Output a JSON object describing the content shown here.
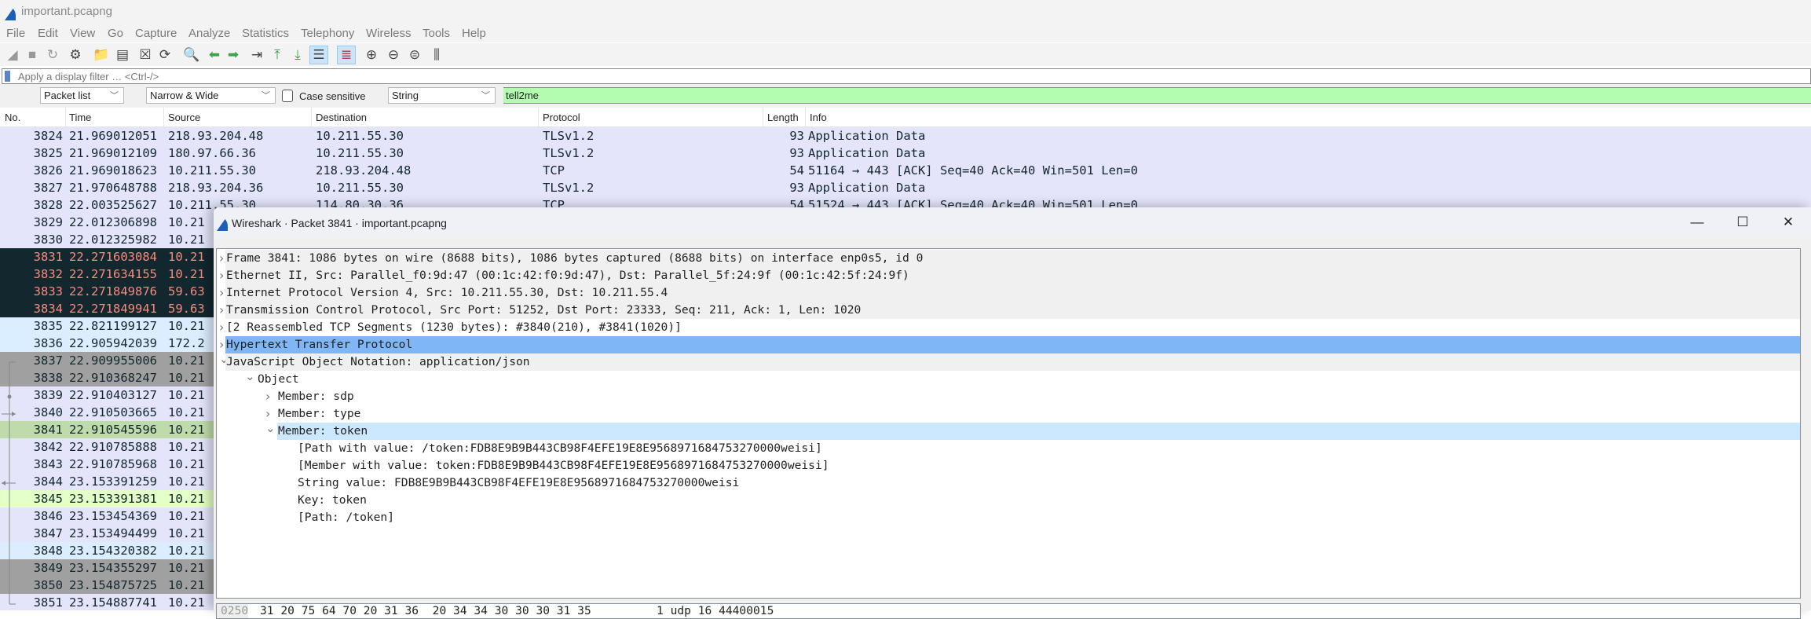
{
  "window": {
    "title": "important.pcapng",
    "icon": "wireshark-fin-icon"
  },
  "menu": [
    "File",
    "Edit",
    "View",
    "Go",
    "Capture",
    "Analyze",
    "Statistics",
    "Telephony",
    "Wireless",
    "Tools",
    "Help"
  ],
  "toolbar": {
    "icons": [
      "start-capture-icon",
      "stop-capture-icon",
      "restart-capture-icon",
      "capture-options-icon",
      "open-file-icon",
      "save-file-icon",
      "close-file-icon",
      "reload-file-icon",
      "find-packet-icon",
      "go-back-icon",
      "go-forward-icon",
      "go-to-packet-icon",
      "go-first-icon",
      "go-last-icon",
      "autoscroll-icon",
      "colorize-icon",
      "zoom-in-icon",
      "zoom-out-icon",
      "normal-size-icon",
      "resize-columns-icon"
    ]
  },
  "display_filter": {
    "placeholder": "Apply a display filter … <Ctrl-/>"
  },
  "find_bar": {
    "search_in": "Packet list",
    "char_width": "Narrow & Wide",
    "case_sensitive_label": "Case sensitive",
    "case_sensitive": false,
    "search_type": "String",
    "search_value": "tell2me"
  },
  "packet_list": {
    "columns": [
      "No.",
      "Time",
      "Source",
      "Destination",
      "Protocol",
      "Length",
      "Info"
    ],
    "rows": [
      {
        "no": "3824",
        "time": "21.969012051",
        "source": "218.93.204.48",
        "destination": "10.211.55.30",
        "protocol": "TLSv1.2",
        "length": "93",
        "info": "Application Data",
        "style": "tcp"
      },
      {
        "no": "3825",
        "time": "21.969012109",
        "source": "180.97.66.36",
        "destination": "10.211.55.30",
        "protocol": "TLSv1.2",
        "length": "93",
        "info": "Application Data",
        "style": "tcp"
      },
      {
        "no": "3826",
        "time": "21.969018623",
        "source": "10.211.55.30",
        "destination": "218.93.204.48",
        "protocol": "TCP",
        "length": "54",
        "info": "51164 → 443 [ACK] Seq=40 Ack=40 Win=501 Len=0",
        "style": "tcp"
      },
      {
        "no": "3827",
        "time": "21.970648788",
        "source": "218.93.204.36",
        "destination": "10.211.55.30",
        "protocol": "TLSv1.2",
        "length": "93",
        "info": "Application Data",
        "style": "tcp"
      },
      {
        "no": "3828",
        "time": "22.003525627",
        "source": "10.211.55.30",
        "destination": "114.80.30.36",
        "protocol": "TCP",
        "length": "54",
        "info": "51524 → 443 [ACK] Seq=40 Ack=40 Win=501 Len=0",
        "style": "tcp"
      },
      {
        "no": "3829",
        "time": "22.012306898",
        "source": "10.21",
        "style": "tcp"
      },
      {
        "no": "3830",
        "time": "22.012325982",
        "source": "10.21",
        "style": "tcp"
      },
      {
        "no": "3831",
        "time": "22.271603084",
        "source": "10.21",
        "style": "bad"
      },
      {
        "no": "3832",
        "time": "22.271634155",
        "source": "10.21",
        "style": "bad"
      },
      {
        "no": "3833",
        "time": "22.271849876",
        "source": "59.63",
        "style": "bad"
      },
      {
        "no": "3834",
        "time": "22.271849941",
        "source": "59.63",
        "style": "bad"
      },
      {
        "no": "3835",
        "time": "22.821199127",
        "source": "10.21",
        "style": "udp"
      },
      {
        "no": "3836",
        "time": "22.905942039",
        "source": "172.2",
        "style": "udp"
      },
      {
        "no": "3837",
        "time": "22.909955006",
        "source": "10.21",
        "style": "gray"
      },
      {
        "no": "3838",
        "time": "22.910368247",
        "source": "10.21",
        "style": "gray"
      },
      {
        "no": "3839",
        "time": "22.910403127",
        "source": "10.21",
        "style": "tcp"
      },
      {
        "no": "3840",
        "time": "22.910503665",
        "source": "10.21",
        "style": "tcp"
      },
      {
        "no": "3841",
        "time": "22.910545596",
        "source": "10.21",
        "style": "selected"
      },
      {
        "no": "3842",
        "time": "22.910785888",
        "source": "10.21",
        "style": "tcp"
      },
      {
        "no": "3843",
        "time": "22.910785968",
        "source": "10.21",
        "style": "tcp"
      },
      {
        "no": "3844",
        "time": "23.153391259",
        "source": "10.21",
        "style": "tcp"
      },
      {
        "no": "3845",
        "time": "23.153391381",
        "source": "10.21",
        "style": "http"
      },
      {
        "no": "3846",
        "time": "23.153454369",
        "source": "10.21",
        "style": "tcp"
      },
      {
        "no": "3847",
        "time": "23.153494499",
        "source": "10.21",
        "style": "tcp"
      },
      {
        "no": "3848",
        "time": "23.154320382",
        "source": "10.21",
        "style": "udp"
      },
      {
        "no": "3849",
        "time": "23.154355297",
        "source": "10.21",
        "style": "gray"
      },
      {
        "no": "3850",
        "time": "23.154875725",
        "source": "10.21",
        "style": "gray"
      },
      {
        "no": "3851",
        "time": "23.154887741",
        "source": "10.21",
        "style": "tcp"
      }
    ]
  },
  "colors": {
    "tcp": {
      "bg": "#e4e4fb",
      "fg": "#12272e"
    },
    "bad": {
      "bg": "#12272e",
      "fg": "#f78b7d"
    },
    "udp": {
      "bg": "#daeeff",
      "fg": "#12272e"
    },
    "gray": {
      "bg": "#a0a0a0",
      "fg": "#12272e"
    },
    "selected": {
      "bg": "#c0dbab",
      "fg": "#12272e"
    },
    "http": {
      "bg": "#e4ffc7",
      "fg": "#12272e"
    },
    "find_match": "#b2fdb0",
    "tree_selected": "#7fb6f5",
    "tree_hover": "#cce8ff"
  },
  "dialog": {
    "title": "Wireshark · Packet 3841 · important.pcapng",
    "tree": [
      {
        "level": 0,
        "arrow": "collapsed",
        "text": "Frame 3841: 1086 bytes on wire (8688 bits), 1086 bytes captured (8688 bits) on interface enp0s5, id 0",
        "state": "alt"
      },
      {
        "level": 0,
        "arrow": "collapsed",
        "text": "Ethernet II, Src: Parallel_f0:9d:47 (00:1c:42:f0:9d:47), Dst: Parallel_5f:24:9f (00:1c:42:5f:24:9f)",
        "state": "alt"
      },
      {
        "level": 0,
        "arrow": "collapsed",
        "text": "Internet Protocol Version 4, Src: 10.211.55.30, Dst: 10.211.55.4",
        "state": "alt"
      },
      {
        "level": 0,
        "arrow": "collapsed",
        "text": "Transmission Control Protocol, Src Port: 51252, Dst Port: 23333, Seq: 211, Ack: 1, Len: 1020",
        "state": "alt"
      },
      {
        "level": 0,
        "arrow": "collapsed",
        "text": "[2 Reassembled TCP Segments (1230 bytes): #3840(210), #3841(1020)]",
        "state": ""
      },
      {
        "level": 0,
        "arrow": "collapsed",
        "text": "Hypertext Transfer Protocol",
        "state": "selected"
      },
      {
        "level": 0,
        "arrow": "expanded",
        "text": "JavaScript Object Notation: application/json",
        "state": "alt"
      },
      {
        "level": 1,
        "arrow": "expanded",
        "text": "Object",
        "state": ""
      },
      {
        "level": 2,
        "arrow": "collapsed",
        "text": "Member: sdp",
        "state": ""
      },
      {
        "level": 2,
        "arrow": "collapsed",
        "text": "Member: type",
        "state": ""
      },
      {
        "level": 2,
        "arrow": "expanded",
        "text": "Member: token",
        "state": "hover"
      },
      {
        "level": 3,
        "arrow": "",
        "text": "[Path with value: /token:FDB8E9B9B443CB98F4EFE19E8E956897168475327000​0weisi]",
        "state": ""
      },
      {
        "level": 3,
        "arrow": "",
        "text": "[Member with value: token:FDB8E9B9B443CB98F4EFE19E8E9568971684753270000weisi]",
        "state": ""
      },
      {
        "level": 3,
        "arrow": "",
        "text": "String value: FDB8E9B9B443CB98F4EFE19E8E9568971684753270000weisi",
        "state": ""
      },
      {
        "level": 3,
        "arrow": "",
        "text": "Key: token",
        "state": ""
      },
      {
        "level": 3,
        "arrow": "",
        "text": "[Path: /token]",
        "state": ""
      }
    ],
    "hex": {
      "offset": "0250",
      "bytes": "31 20 75 64 70 20 31 36  20 34 34 30 30 30 31 35",
      "ascii": "1 udp 16 44400015"
    }
  }
}
